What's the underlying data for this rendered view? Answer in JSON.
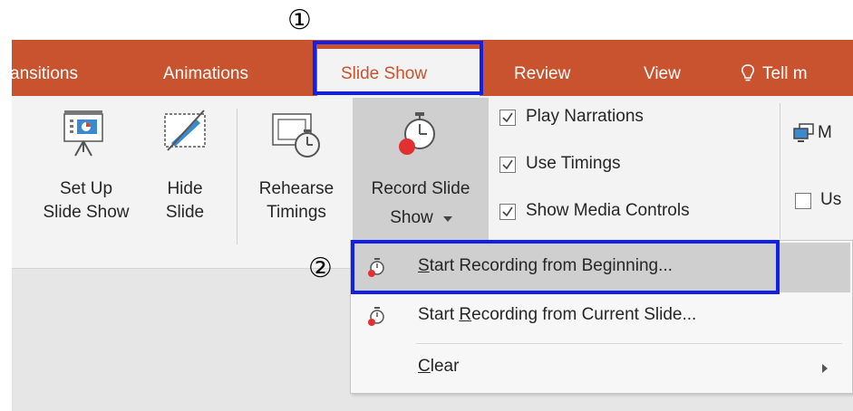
{
  "tabs": {
    "transitions": "ansitions",
    "animations": "Animations",
    "slide_show": "Slide Show",
    "review": "Review",
    "view": "View",
    "tell_me": "Tell m"
  },
  "ribbon": {
    "setup_line1": "Set Up",
    "setup_line2": "Slide Show",
    "hide_line1": "Hide",
    "hide_line2": "Slide",
    "rehearse_line1": "Rehearse",
    "rehearse_line2": "Timings",
    "record_line1": "Record Slide",
    "record_line2": "Show",
    "play_narrations": "Play Narrations",
    "use_timings": "Use Timings",
    "show_media_controls": "Show Media Controls",
    "monitor_partial": "M",
    "use_partial": "Us"
  },
  "menu": {
    "start_beginning": {
      "pre": "",
      "underlined": "S",
      "post": "tart Recording from Beginning..."
    },
    "start_current": {
      "pre": "Start ",
      "underlined": "R",
      "post": "ecording from Current Slide..."
    },
    "clear": {
      "pre": "",
      "underlined": "C",
      "post": "lear"
    }
  },
  "callouts": {
    "one": "①",
    "two": "②"
  },
  "colors": {
    "tab_bar": "#c9532e",
    "callout_border": "#1020e8",
    "highlight": "#cfcfcf"
  }
}
